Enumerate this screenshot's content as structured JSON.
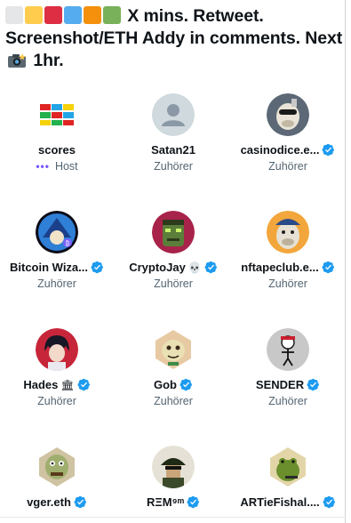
{
  "header": {
    "squares": [
      "#e4e6e8",
      "#ffcc4d",
      "#dd2e44",
      "#55acee",
      "#f4900c",
      "#78b159"
    ],
    "text_part1": " X mins. Retweet. Screenshot/ETH Addy in comments. Next ",
    "text_part2": " 1hr."
  },
  "participants": [
    {
      "name": "scores",
      "role": "Host",
      "avatar_icon": "scores-logo-icon",
      "verified": false,
      "emoji": ""
    },
    {
      "name": "Satan21",
      "role": "Zuhörer",
      "avatar_icon": "default-avatar-icon",
      "verified": false,
      "emoji": ""
    },
    {
      "name": "casinodice.e...",
      "role": "Zuhörer",
      "avatar_icon": "ape-avatar-icon",
      "verified": true,
      "emoji": ""
    },
    {
      "name": "Bitcoin Wiza...",
      "role": "Zuhörer",
      "avatar_icon": "wizard-avatar-icon",
      "verified": true,
      "emoji": ""
    },
    {
      "name": "CryptoJay",
      "role": "Zuhörer",
      "avatar_icon": "zombie-avatar-icon",
      "verified": true,
      "emoji": "💀"
    },
    {
      "name": "nftapeclub.e...",
      "role": "Zuhörer",
      "avatar_icon": "ape-cap-avatar-icon",
      "verified": true,
      "emoji": ""
    },
    {
      "name": "Hades",
      "role": "Zuhörer",
      "avatar_icon": "anime-avatar-icon",
      "verified": true,
      "emoji": "🏛"
    },
    {
      "name": "Gob",
      "role": "Zuhörer",
      "avatar_icon": "goblin-avatar-icon",
      "verified": true,
      "emoji": ""
    },
    {
      "name": "SENDER",
      "role": "Zuhörer",
      "avatar_icon": "stickman-avatar-icon",
      "verified": true,
      "emoji": ""
    },
    {
      "name": "vger.eth",
      "role": "",
      "avatar_icon": "troll-avatar-icon",
      "verified": true,
      "emoji": ""
    },
    {
      "name": "RΞM⁹ᵐ",
      "role": "",
      "avatar_icon": "soldier-avatar-icon",
      "verified": true,
      "emoji": ""
    },
    {
      "name": "ARTieFishal....",
      "role": "",
      "avatar_icon": "frog-avatar-icon",
      "verified": true,
      "emoji": ""
    }
  ],
  "colors": {
    "verified": "#1d9bf0",
    "host": "#7856ff",
    "secondary_text": "#536471"
  }
}
